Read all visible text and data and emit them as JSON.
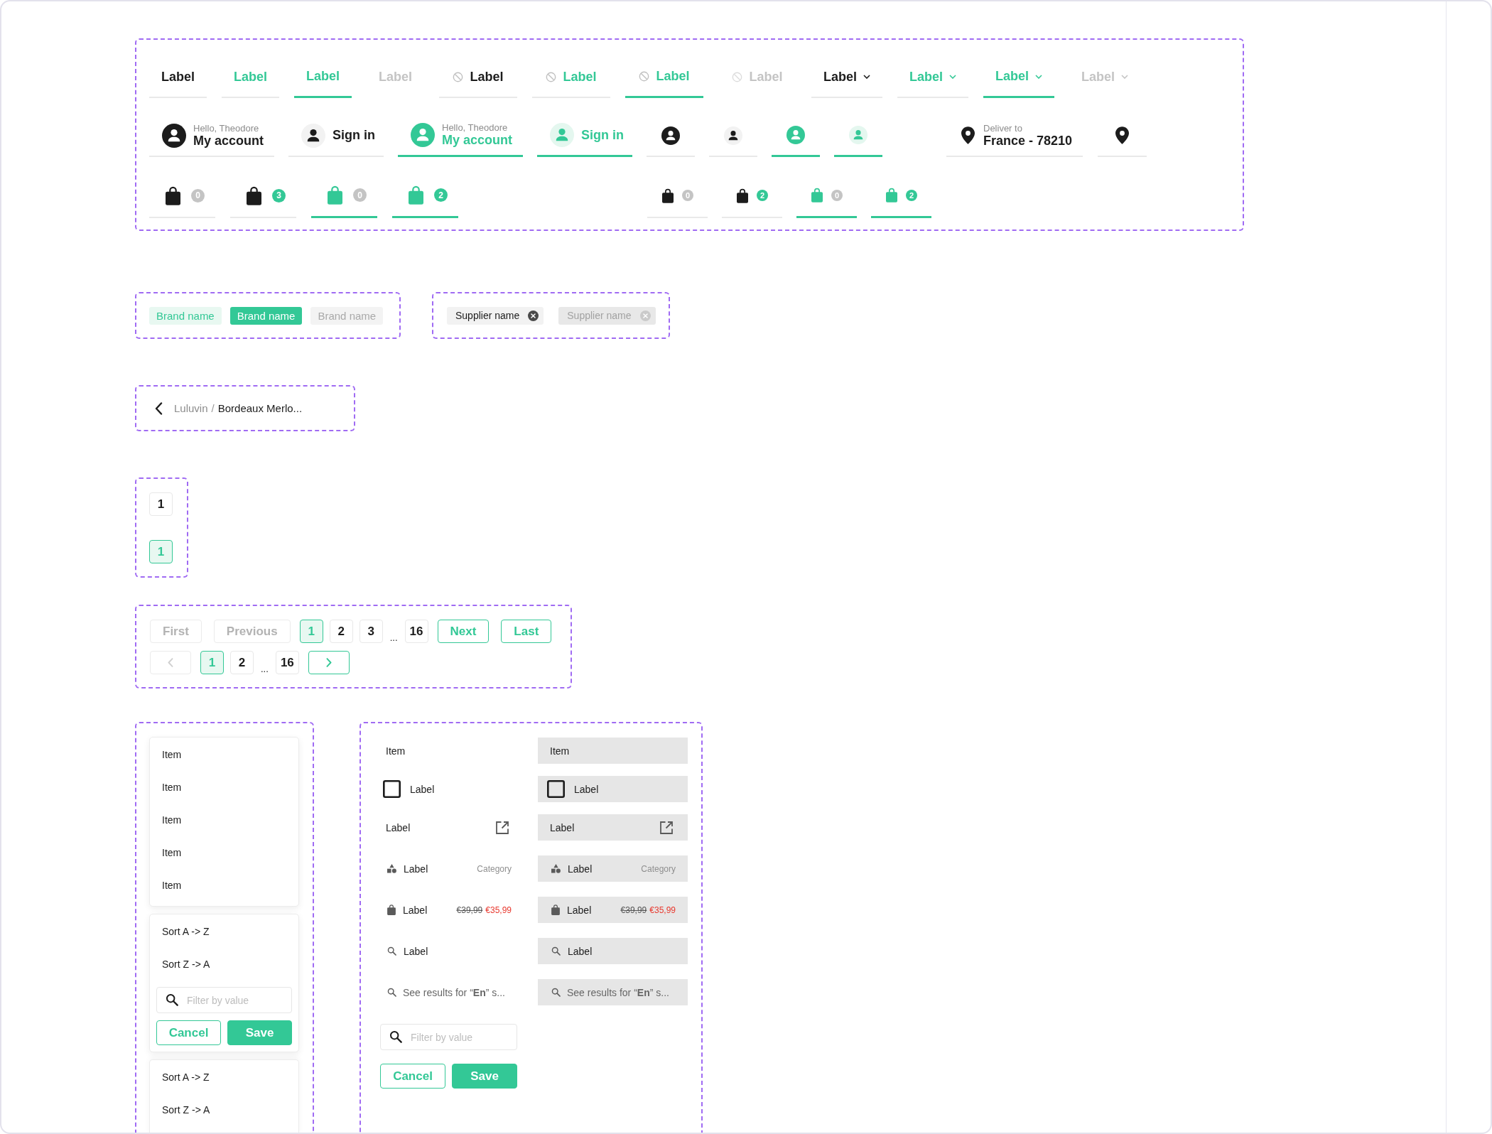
{
  "navigation": {
    "tabs": [
      {
        "kind": "plain",
        "label": "Label",
        "selected": false,
        "hovered": false,
        "disabled": false
      },
      {
        "kind": "plain",
        "label": "Label",
        "selected": false,
        "hovered": true,
        "disabled": false
      },
      {
        "kind": "plain",
        "label": "Label",
        "selected": true,
        "hovered": false,
        "disabled": false
      },
      {
        "kind": "plain",
        "label": "Label",
        "selected": false,
        "hovered": false,
        "disabled": true
      },
      {
        "kind": "icon",
        "label": "Label",
        "selected": false,
        "hovered": false,
        "disabled": false
      },
      {
        "kind": "icon",
        "label": "Label",
        "selected": false,
        "hovered": true,
        "disabled": false
      },
      {
        "kind": "icon",
        "label": "Label",
        "selected": true,
        "hovered": false,
        "disabled": false
      },
      {
        "kind": "icon",
        "label": "Label",
        "selected": false,
        "hovered": false,
        "disabled": true
      },
      {
        "kind": "dropdown",
        "label": "Label",
        "selected": false,
        "hovered": false,
        "disabled": false
      },
      {
        "kind": "dropdown",
        "label": "Label",
        "selected": false,
        "hovered": true,
        "disabled": false
      },
      {
        "kind": "dropdown",
        "label": "Label",
        "selected": true,
        "hovered": false,
        "disabled": false
      },
      {
        "kind": "dropdown",
        "label": "Label",
        "selected": false,
        "hovered": false,
        "disabled": true
      }
    ],
    "account_items": [
      {
        "kind": "member",
        "greeting": "Hello, Theodore",
        "label": "My account",
        "selected": false
      },
      {
        "kind": "guest",
        "label": "Sign in",
        "selected": false
      },
      {
        "kind": "member",
        "greeting": "Hello, Theodore",
        "label": "My account",
        "selected": true
      },
      {
        "kind": "guest",
        "label": "Sign in",
        "selected": true
      },
      {
        "kind": "member",
        "selected": false
      },
      {
        "kind": "guest",
        "selected": false
      },
      {
        "kind": "member",
        "selected": true
      },
      {
        "kind": "guest",
        "selected": true
      }
    ],
    "location_items": [
      {
        "caption": "Deliver to",
        "label": "France - 78210",
        "selected": false
      },
      {
        "selected": false
      }
    ],
    "cart_groups": [
      {
        "kind": "regular",
        "items": [
          {
            "count": "0",
            "empty": true,
            "selected": false
          },
          {
            "count": "3",
            "empty": false,
            "selected": false
          },
          {
            "count": "0",
            "empty": true,
            "selected": true
          },
          {
            "count": "2",
            "empty": false,
            "selected": true
          }
        ]
      },
      {
        "kind": "compact",
        "items": [
          {
            "count": "0",
            "empty": true,
            "selected": false
          },
          {
            "count": "2",
            "empty": false,
            "selected": false
          },
          {
            "count": "0",
            "empty": true,
            "selected": true
          },
          {
            "count": "2",
            "empty": false,
            "selected": true
          }
        ]
      }
    ]
  },
  "brand_chips": [
    {
      "label": "Brand name",
      "selected": false,
      "disabled": false
    },
    {
      "label": "Brand name",
      "selected": true,
      "disabled": false
    },
    {
      "label": "Brand name",
      "selected": false,
      "disabled": true
    }
  ],
  "supplier_chips": [
    {
      "label": "Supplier name",
      "disabled": false
    },
    {
      "label": "Supplier name",
      "disabled": true
    }
  ],
  "breadcrumb": {
    "crumbs": [
      {
        "label": "Luluvin",
        "current": false
      },
      {
        "label": "Bordeaux Merlo...",
        "current": true
      }
    ],
    "separator": "/"
  },
  "page_states": [
    {
      "label": "1",
      "selected": false
    },
    {
      "label": "1",
      "selected": true
    }
  ],
  "pagination": {
    "rows": [
      {
        "items": [
          {
            "kind": "text",
            "label": "First",
            "disabled": true
          },
          {
            "kind": "text",
            "label": "Previous",
            "disabled": true
          },
          {
            "kind": "page",
            "label": "1",
            "selected": true
          },
          {
            "kind": "page",
            "label": "2",
            "selected": false
          },
          {
            "kind": "page",
            "label": "3",
            "selected": false
          },
          {
            "kind": "ellipsis",
            "label": "..."
          },
          {
            "kind": "page",
            "label": "16",
            "selected": false
          },
          {
            "kind": "text",
            "label": "Next",
            "disabled": false
          },
          {
            "kind": "text",
            "label": "Last",
            "disabled": false
          }
        ]
      },
      {
        "items": [
          {
            "kind": "previous_arrow",
            "disabled": true
          },
          {
            "kind": "page",
            "label": "1",
            "selected": true
          },
          {
            "kind": "page",
            "label": "2",
            "selected": false
          },
          {
            "kind": "ellipsis",
            "label": "..."
          },
          {
            "kind": "page",
            "label": "16",
            "selected": false
          },
          {
            "kind": "next_arrow",
            "disabled": false
          }
        ]
      }
    ]
  },
  "dropdown_menus": [
    {
      "options": [
        "Item",
        "Item",
        "Item",
        "Item",
        "Item"
      ]
    },
    {
      "options": [
        "Sort A -> Z",
        "Sort Z -> A"
      ],
      "filter": {
        "placeholder": "Filter by value"
      },
      "buttons": [
        {
          "kind": "secondary",
          "label": "Cancel"
        },
        {
          "kind": "primary",
          "label": "Save"
        }
      ]
    },
    {
      "options": [
        "Sort A -> Z",
        "Sort Z -> A"
      ]
    }
  ],
  "menu_variants": {
    "columns": [
      {
        "hovered": false,
        "rows": [
          {
            "kind": "text",
            "label": "Item"
          },
          {
            "kind": "checkbox",
            "label": "Label",
            "checked": false
          },
          {
            "kind": "link",
            "label": "Label"
          },
          {
            "kind": "category",
            "label": "Label",
            "category": "Category"
          },
          {
            "kind": "product",
            "label": "Label",
            "old_price": "€39,99",
            "price": "€35,99"
          },
          {
            "kind": "search",
            "label": "Label"
          },
          {
            "kind": "see_all",
            "label": "See results for “**En**” s..."
          }
        ]
      },
      {
        "hovered": true,
        "rows": [
          {
            "kind": "text",
            "label": "Item"
          },
          {
            "kind": "checkbox",
            "label": "Label",
            "checked": false
          },
          {
            "kind": "link",
            "label": "Label"
          },
          {
            "kind": "category",
            "label": "Label",
            "category": "Category"
          },
          {
            "kind": "product",
            "label": "Label",
            "old_price": "€39,99",
            "price": "€35,99"
          },
          {
            "kind": "search",
            "label": "Label"
          },
          {
            "kind": "see_all",
            "label": "See results for “**En**” s..."
          }
        ]
      }
    ],
    "filter": {
      "placeholder": "Filter by value"
    },
    "buttons": [
      {
        "kind": "secondary",
        "label": "Cancel"
      },
      {
        "kind": "primary",
        "label": "Save"
      }
    ]
  }
}
